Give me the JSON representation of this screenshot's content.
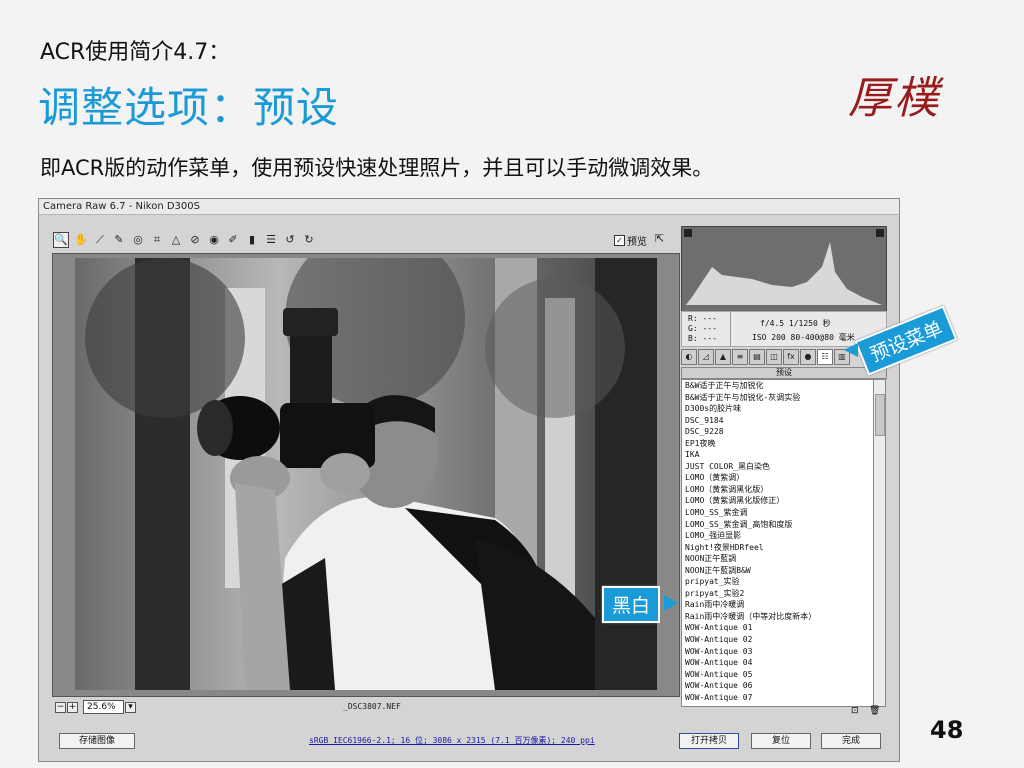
{
  "slide": {
    "subtitle": "ACR使用简介4.7：",
    "title": "调整选项：预设",
    "logo": "厚樸",
    "description": "即ACR版的动作菜单，使用预设快速处理照片，并且可以手动微调效果。",
    "page_number": "48"
  },
  "window": {
    "title": "Camera Raw 6.7 -  Nikon D300S",
    "preview_label": "预览",
    "zoom_value": "25.6%",
    "filename": "_DSC3807.NEF",
    "readout": {
      "r": "R:  ---",
      "g": "G:  ---",
      "b": "B:  ---",
      "exposure": "f/4.5   1/1250 秒",
      "iso": "ISO 200   80-400@80 毫米"
    },
    "panel_title": "预设",
    "presets": [
      "B&W适于正午与加锐化",
      "B&W适于正午与加锐化-灰调实验",
      "D300s的胶片味",
      "DSC_9184",
      "DSC_9228",
      "EP1夜晚",
      "IKA",
      "JUST COLOR_黑白染色",
      "LOMO（黄紫调）",
      "LOMO（黄紫调黑化版）",
      "LOMO（黄紫调黑化版修正）",
      "LOMO_SS_紫金调",
      "LOMO_SS_紫金调_高饱和度版",
      "LOMO_强迫显影",
      "Night!夜景HDRfeel",
      "NOON正午藍調",
      "NOON正午藍調B&W",
      "pripyat_实验",
      "pripyat_实验2",
      "Rain雨中冷暖调",
      "Rain雨中冷暖调（中等对比度新本）",
      "WOW-Antique 01",
      "WOW-Antique 02",
      "WOW-Antique 03",
      "WOW-Antique 04",
      "WOW-Antique 05",
      "WOW-Antique 06",
      "WOW-Antique 07"
    ],
    "save_button": "存储图像",
    "workflow_link": "sRGB IEC61966-2.1; 16 位; 3086 x 2315 (7.1 百万像素); 240 ppi",
    "open_button": "打开拷贝",
    "reset_button": "复位",
    "done_button": "完成"
  },
  "callouts": {
    "preset_menu": "预设菜单",
    "black_white": "黑白"
  }
}
